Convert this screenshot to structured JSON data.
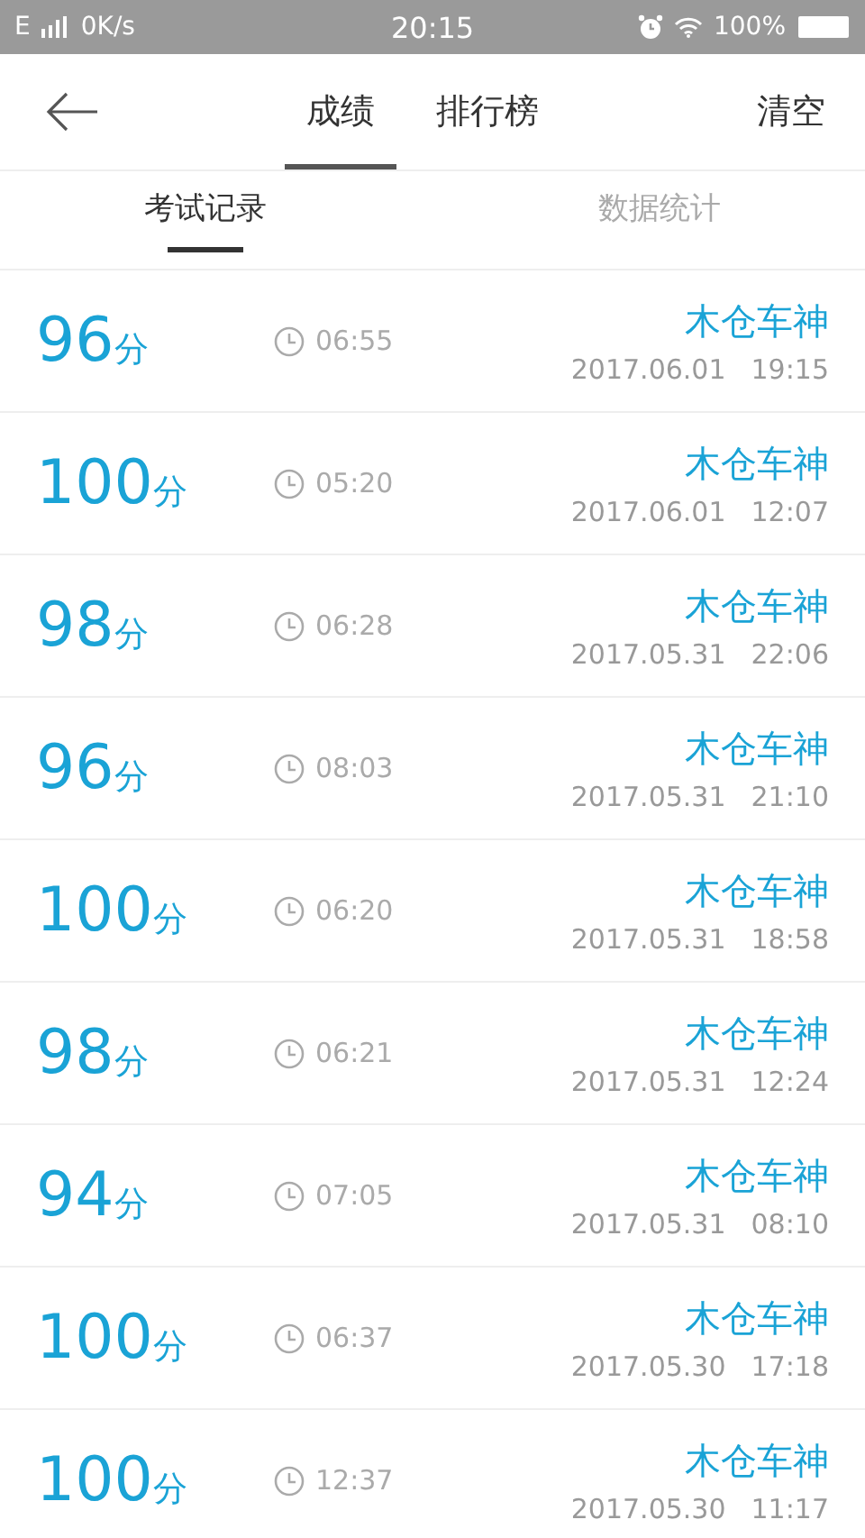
{
  "status_bar": {
    "network": "E",
    "speed": "0K/s",
    "time": "20:15",
    "battery": "100%"
  },
  "header": {
    "tabs": [
      {
        "label": "成绩",
        "selected": true
      },
      {
        "label": "排行榜",
        "selected": false
      }
    ],
    "action": "清空"
  },
  "sub_tabs": [
    {
      "label": "考试记录",
      "selected": true
    },
    {
      "label": "数据统计",
      "selected": false
    }
  ],
  "records": [
    {
      "score": "96",
      "unit": "分",
      "duration": "06:55",
      "title": "木仓车神",
      "date": "2017.06.01",
      "time": "19:15"
    },
    {
      "score": "100",
      "unit": "分",
      "duration": "05:20",
      "title": "木仓车神",
      "date": "2017.06.01",
      "time": "12:07"
    },
    {
      "score": "98",
      "unit": "分",
      "duration": "06:28",
      "title": "木仓车神",
      "date": "2017.05.31",
      "time": "22:06"
    },
    {
      "score": "96",
      "unit": "分",
      "duration": "08:03",
      "title": "木仓车神",
      "date": "2017.05.31",
      "time": "21:10"
    },
    {
      "score": "100",
      "unit": "分",
      "duration": "06:20",
      "title": "木仓车神",
      "date": "2017.05.31",
      "time": "18:58"
    },
    {
      "score": "98",
      "unit": "分",
      "duration": "06:21",
      "title": "木仓车神",
      "date": "2017.05.31",
      "time": "12:24"
    },
    {
      "score": "94",
      "unit": "分",
      "duration": "07:05",
      "title": "木仓车神",
      "date": "2017.05.31",
      "time": "08:10"
    },
    {
      "score": "100",
      "unit": "分",
      "duration": "06:37",
      "title": "木仓车神",
      "date": "2017.05.30",
      "time": "17:18"
    },
    {
      "score": "100",
      "unit": "分",
      "duration": "12:37",
      "title": "木仓车神",
      "date": "2017.05.30",
      "time": "11:17"
    }
  ]
}
